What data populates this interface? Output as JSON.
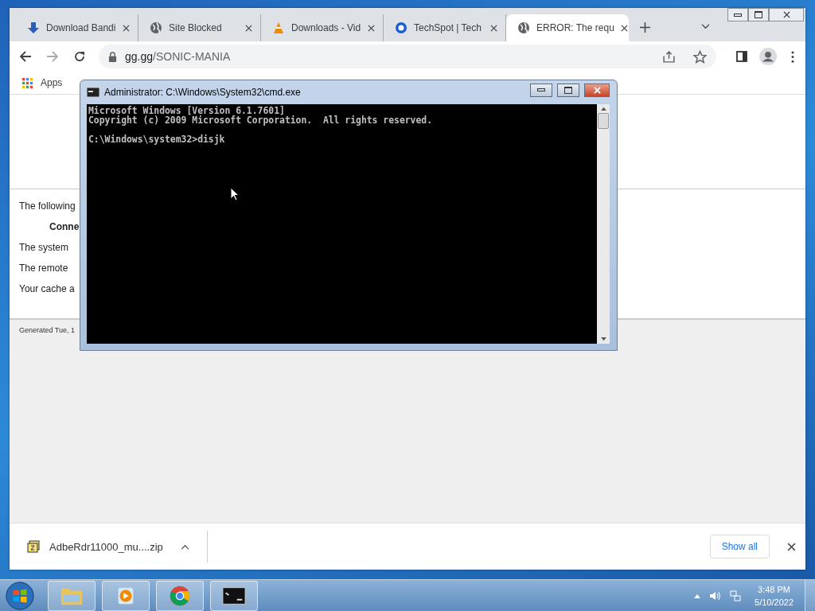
{
  "browser": {
    "tabs": [
      {
        "title": "Download Bandi",
        "kind": "arrow",
        "selected": false
      },
      {
        "title": "Site Blocked",
        "kind": "globe",
        "selected": false
      },
      {
        "title": "Downloads - Vid",
        "kind": "cone",
        "selected": false
      },
      {
        "title": "TechSpot | Tech",
        "kind": "ring",
        "selected": false
      },
      {
        "title": "ERROR: The requ",
        "kind": "globe",
        "selected": true
      }
    ],
    "address": {
      "host": "gg.gg",
      "path": "/SONIC-MANIA"
    },
    "bookmarks": [
      "Apps"
    ],
    "page": {
      "lines": [
        {
          "kind": "text",
          "text": "The following"
        },
        {
          "kind": "heading",
          "text": "Conne"
        },
        {
          "kind": "text",
          "text": "The system"
        },
        {
          "kind": "text",
          "text": "The remote"
        },
        {
          "kind": "text",
          "text": "Your cache a"
        }
      ],
      "footer": "Generated Tue, 1"
    },
    "downloads": {
      "file": "AdbeRdr11000_mu....zip",
      "button": "Show all"
    }
  },
  "console": {
    "title": "Administrator: C:\\Windows\\System32\\cmd.exe",
    "lines": [
      "Microsoft Windows [Version 6.1.7601]",
      "Copyright (c) 2009 Microsoft Corporation.  All rights reserved."
    ],
    "prompt": "C:\\Windows\\system32>disjk"
  },
  "taskbar": {
    "apps": [
      {
        "kind": "folder"
      },
      {
        "kind": "media"
      },
      {
        "kind": "chrome"
      },
      {
        "kind": "terminal"
      }
    ],
    "time": "3:48 PM",
    "date": "5/10/2022"
  }
}
